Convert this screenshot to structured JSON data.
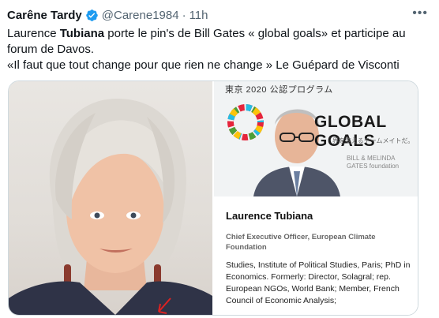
{
  "tweet": {
    "author_name": "Carêne Tardy",
    "handle": "@Carene1984",
    "separator": "·",
    "time": "11h",
    "more_icon": "ellipsis-icon",
    "text_line1_before": "Laurence ",
    "text_line1_bold": "Tubiana",
    "text_line1_after": " porte le pin's de Bill Gates « global goals» et participe au forum de Davos.",
    "text_line2": "«Il faut que tout change pour que rien ne change » Le Guépard de Visconti"
  },
  "right_image": {
    "banner_top": "東京 2020 公認プログラム",
    "global_goals": "GLOBAL GOALS",
    "jp_subtitle": "界を変えるチームメイトだ。",
    "bmg_line1": "BILL & MELINDA",
    "bmg_line2": "GATES foundation"
  },
  "card": {
    "name": "Laurence Tubiana",
    "role": "Chief Executive Officer, European Climate Foundation",
    "bio": "Studies, Institute of Political Studies, Paris; PhD in Economics. Formerly: Director, Solagral; rep. European NGOs, World Bank; Member, French Council of Economic Analysis;"
  },
  "colors": {
    "verified": "#1d9bf0",
    "text": "#0f1419",
    "muted": "#536471"
  }
}
